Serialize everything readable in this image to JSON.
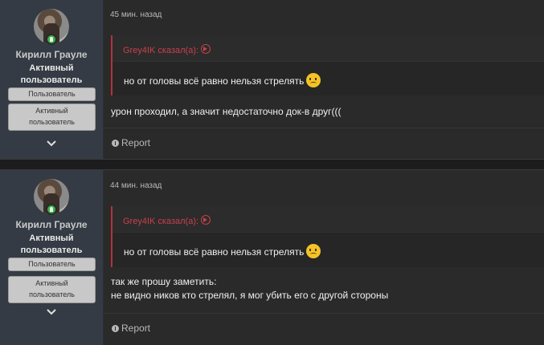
{
  "posts": [
    {
      "user": {
        "name": "Кирилл Грауле",
        "title_line1": "Активный",
        "title_line2": "пользователь",
        "banner1": "Пользователь",
        "banner2_line1": "Активный",
        "banner2_line2": "пользователь"
      },
      "time": "45 мин. назад",
      "quote": {
        "author": "Grey4IK сказал(а):",
        "text": "но от головы всё равно нельзя стрелять"
      },
      "body_line1": "урон проходил, а значит недостаточно док-в друг(((",
      "body_line2": "",
      "report_label": "Report"
    },
    {
      "user": {
        "name": "Кирилл Грауле",
        "title_line1": "Активный",
        "title_line2": "пользователь",
        "banner1": "Пользователь",
        "banner2_line1": "Активный",
        "banner2_line2": "пользователь"
      },
      "time": "44 мин. назад",
      "quote": {
        "author": "Grey4IK сказал(а):",
        "text": "но от головы всё равно нельзя стрелять"
      },
      "body_line1": "так же прошу заметить:",
      "body_line2": "не видно ников кто стрелял, я мог убить его с другой стороны",
      "report_label": "Report"
    }
  ],
  "colors": {
    "quote_accent": "#c8404a",
    "online": "#3cb04a",
    "user_column": "#353b44"
  },
  "icons": [
    "online-status-icon",
    "quote-link-icon",
    "sad-emoji-icon",
    "chevron-down-icon",
    "report-info-icon"
  ]
}
